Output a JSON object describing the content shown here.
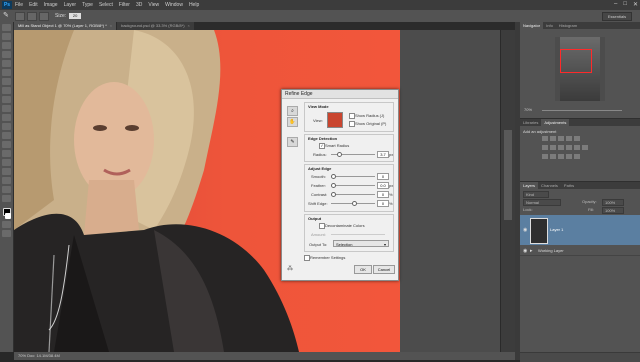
{
  "app": {
    "logo": "Ps"
  },
  "menu": [
    "File",
    "Edit",
    "Image",
    "Layer",
    "Type",
    "Select",
    "Filter",
    "3D",
    "View",
    "Window",
    "Help"
  ],
  "window_controls": [
    "–",
    "□",
    "✕"
  ],
  "options_bar": {
    "size_label": "Size:",
    "size_value": "20",
    "workspace": "Essentials"
  },
  "tabs": [
    {
      "label": "Mill as Stand Object 1 @ 70% (Layer 1, RGB/8*) *",
      "active": true
    },
    {
      "label": "background.psd @ 33.3% (RGB/8*)",
      "active": false
    }
  ],
  "status": {
    "text": "70%   Doc: 14.1M/38.4M"
  },
  "right_panel": {
    "nav_tabs": [
      "Navigator",
      "Info",
      "Histogram"
    ],
    "zoom": "70%",
    "adj_tabs": [
      "Libraries",
      "Adjustments"
    ],
    "adj_header": "Add an adjustment",
    "layer_tabs": [
      "Layers",
      "Channels",
      "Paths"
    ],
    "kind_label": "Kind",
    "blend_mode": "Normal",
    "opacity_label": "Opacity:",
    "opacity": "100%",
    "lock_label": "Lock:",
    "fill_label": "Fill:",
    "fill": "100%",
    "layer1": "Layer 1",
    "layer2": "Working Layer"
  },
  "dialog": {
    "title": "Refine Edge",
    "view_mode": {
      "header": "View Mode",
      "view_label": "View:",
      "show_radius": "Show Radius (J)",
      "show_original": "Show Original (P)"
    },
    "edge_detection": {
      "header": "Edge Detection",
      "smart_radius": "Smart Radius",
      "radius_label": "Radius:",
      "radius_value": "3.7",
      "radius_unit": "px"
    },
    "adjust_edge": {
      "header": "Adjust Edge",
      "smooth_label": "Smooth:",
      "smooth_value": "0",
      "feather_label": "Feather:",
      "feather_value": "0.0",
      "feather_unit": "px",
      "contrast_label": "Contrast:",
      "contrast_value": "0",
      "contrast_unit": "%",
      "shift_label": "Shift Edge:",
      "shift_value": "0",
      "shift_unit": "%"
    },
    "output": {
      "header": "Output",
      "decontaminate": "Decontaminate Colors",
      "amount_label": "Amount:",
      "output_to_label": "Output To:",
      "output_to_value": "Selection"
    },
    "remember": "Remember Settings",
    "ok": "OK",
    "cancel": "Cancel"
  },
  "colors": {
    "background_red": "#ea4f35",
    "layer_selected": "#5b7fa1",
    "canvas_gray": "#4c4c4c"
  }
}
